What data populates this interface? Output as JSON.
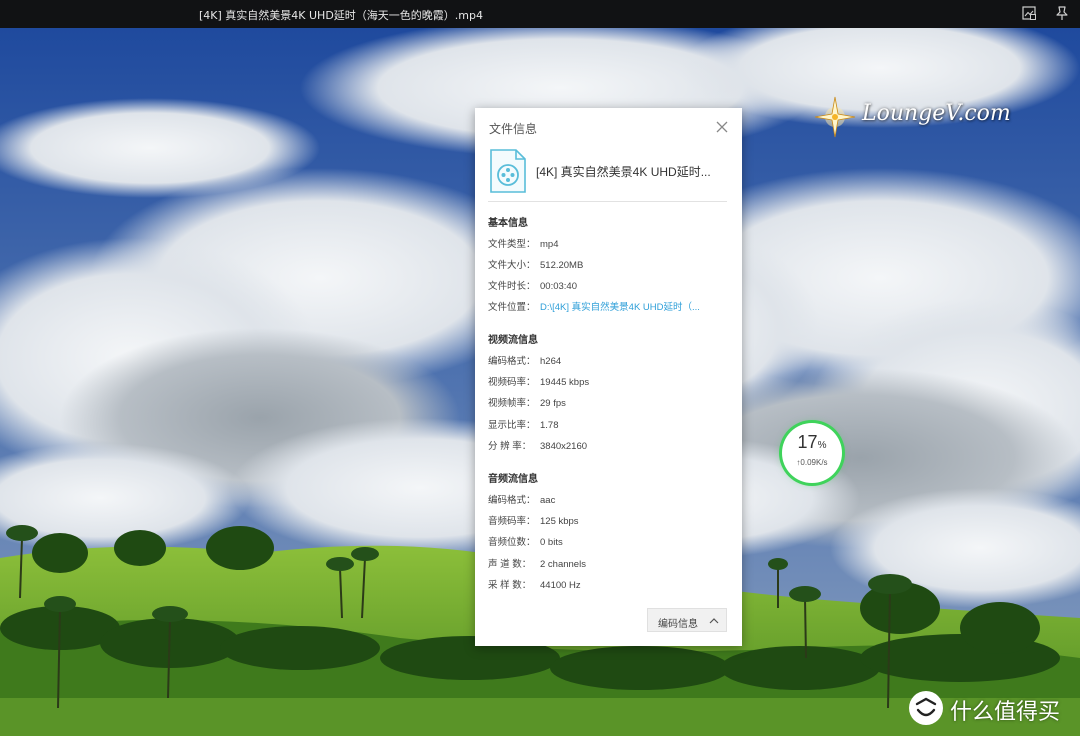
{
  "window": {
    "title": "[4K] 真实自然美景4K UHD延时（海天一色的晚霞）.mp4"
  },
  "overlay": {
    "watermark": "LoungeV.com",
    "speed_percent": "17",
    "speed_percent_sign": "%",
    "speed_rate": "↑0.09K/s",
    "brand_text": "什么值得买"
  },
  "dialog": {
    "title": "文件信息",
    "file_name": "[4K] 真实自然美景4K UHD延时...",
    "basic": {
      "heading": "基本信息",
      "rows": [
        {
          "label": "文件类型：",
          "value": "mp4"
        },
        {
          "label": "文件大小：",
          "value": "512.20MB"
        },
        {
          "label": "文件时长：",
          "value": "00:03:40"
        },
        {
          "label": "文件位置：",
          "value": "D:\\[4K] 真实自然美景4K UHD延时（..."
        }
      ]
    },
    "video": {
      "heading": "视频流信息",
      "rows": [
        {
          "label": "编码格式：",
          "value": "h264"
        },
        {
          "label": "视频码率：",
          "value": "19445 kbps"
        },
        {
          "label": "视频帧率：",
          "value": "29 fps"
        },
        {
          "label": "显示比率：",
          "value": "1.78"
        },
        {
          "label": "分  辨  率：",
          "value": "3840x2160"
        }
      ]
    },
    "audio": {
      "heading": "音频流信息",
      "rows": [
        {
          "label": "编码格式：",
          "value": "aac"
        },
        {
          "label": "音频码率：",
          "value": "125 kbps"
        },
        {
          "label": "音频位数：",
          "value": "0 bits"
        },
        {
          "label": "声  道  数：",
          "value": "2 channels"
        },
        {
          "label": "采  样  数：",
          "value": "44100 Hz"
        }
      ]
    },
    "codec_button": "编码信息"
  },
  "colors": {
    "link": "#2f9fd8",
    "speed_ring": "#3fd35b",
    "titlebar_bg": "#111214",
    "sky": "#2a55a8"
  },
  "icons": {
    "file": "video-file-icon",
    "close": "close-icon",
    "codec_toggle": "chevron-up-icon",
    "titlebar_1": "screenshot-icon",
    "titlebar_2": "pin-icon"
  }
}
